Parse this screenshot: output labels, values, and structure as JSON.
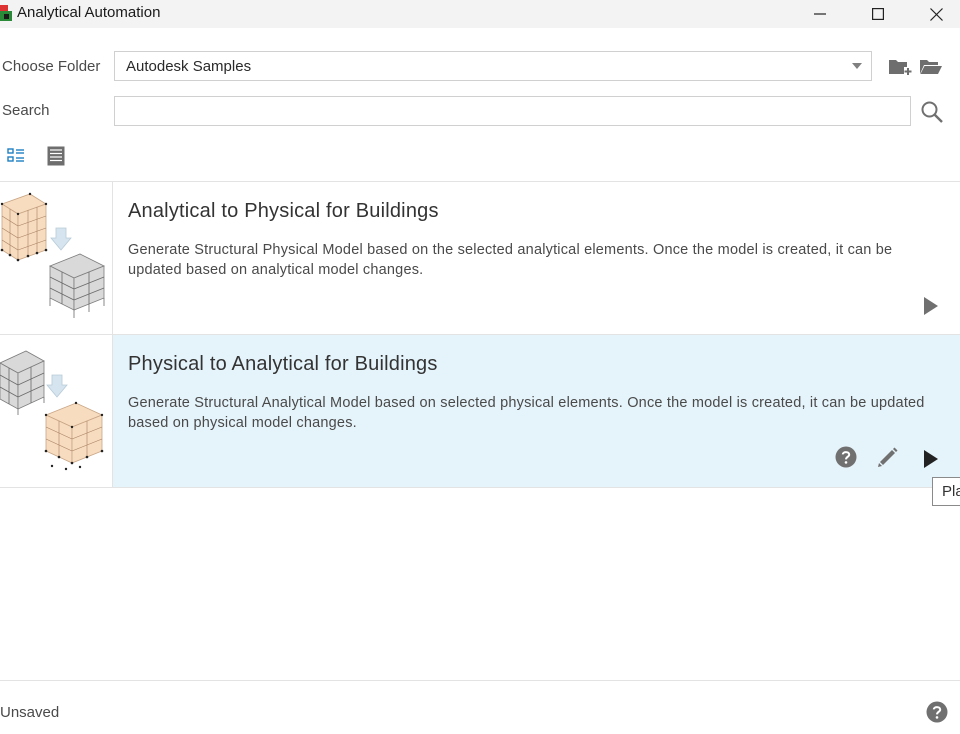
{
  "window": {
    "title": "Analytical Automation"
  },
  "folder": {
    "label": "Choose Folder",
    "selected": "Autodesk Samples"
  },
  "search": {
    "label": "Search",
    "value": "",
    "placeholder": ""
  },
  "toolbar": {
    "new_folder_icon": "add-folder-icon",
    "open_folder_icon": "open-folder-icon",
    "search_icon": "search-icon",
    "list_view_icon": "list-view-icon",
    "detail_view_icon": "detail-view-icon"
  },
  "scripts": [
    {
      "title": "Analytical to Physical for Buildings",
      "description": "Generate Structural Physical Model based on the selected analytical elements. Once the model is created, it can be updated based on analytical model changes."
    },
    {
      "title": "Physical to Analytical for Buildings",
      "description": "Generate Structural Analytical Model based on selected physical elements. Once the model is created, it can be updated based on physical model changes."
    }
  ],
  "tooltip": {
    "text": "Pla"
  },
  "status": {
    "text": "Unsaved"
  },
  "colors": {
    "selected_row": "#e5f3fa",
    "accent": "#1e7fc4",
    "icon_gray": "#707070"
  }
}
